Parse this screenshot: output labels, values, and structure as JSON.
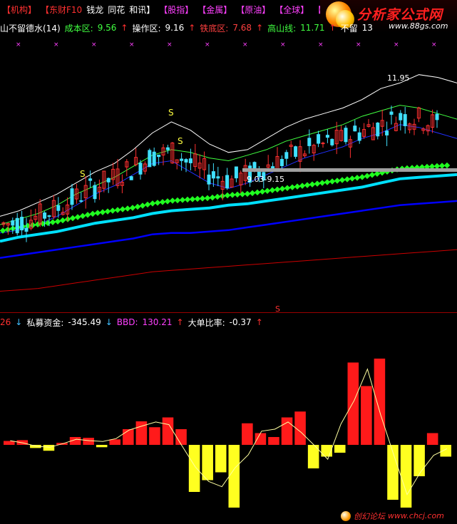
{
  "menu": [
    {
      "label": "【机构】",
      "color": "#ff3030"
    },
    {
      "label": "【东财F10",
      "color": "#ff3030"
    },
    {
      "label": "钱龙",
      "color": "#ffffff"
    },
    {
      "label": "同花",
      "color": "#ffffff"
    },
    {
      "label": "和讯】",
      "color": "#ffffff"
    },
    {
      "label": "【股指】",
      "color": "#ff40ff"
    },
    {
      "label": "【金属】",
      "color": "#ff40ff"
    },
    {
      "label": "【原油】",
      "color": "#ff40ff"
    },
    {
      "label": "【全球】",
      "color": "#ff40ff"
    },
    {
      "label": "【",
      "color": "#ff40ff"
    }
  ],
  "logo": {
    "text": "分析家公式网",
    "url": "www.88gs.com"
  },
  "indicator_main": {
    "name": "山不留德水(14)",
    "items": [
      {
        "label": "成本区:",
        "value": "9.56",
        "color": "#40ff40",
        "arrow": "↑"
      },
      {
        "label": "操作区:",
        "value": "9.16",
        "color": "#ffffff",
        "arrow": "↑"
      },
      {
        "label": "铁底区:",
        "value": "7.68",
        "color": "#ff4040",
        "arrow": "↑"
      },
      {
        "label": "高山线:",
        "value": "11.71",
        "color": "#40ff40",
        "arrow": "↑"
      },
      {
        "label": "不留",
        "value": "13",
        "color": "#ffffff",
        "arrow": ""
      }
    ]
  },
  "indicator_sub": {
    "prefix": "26",
    "prefix_arrow": "↓",
    "items": [
      {
        "label": "私募资金:",
        "value": "-345.49",
        "color": "#ffffff",
        "arrow": "↓",
        "arrow_color": "#40c0ff"
      },
      {
        "label": "BBD:",
        "value": "130.21",
        "color": "#ff40ff",
        "arrow": "↑",
        "arrow_color": "#ff3030"
      },
      {
        "label": "大单比率:",
        "value": "-0.37",
        "color": "#ffffff",
        "arrow": "↑",
        "arrow_color": "#ff3030"
      }
    ]
  },
  "annotations": {
    "high": "11.95",
    "band": "9.03-9.15",
    "sell_marker": "S"
  },
  "footer": {
    "text": "创幻论坛",
    "url": "www.chcj.com"
  },
  "chart_data": [
    {
      "type": "line",
      "series": [
        {
          "color": "#ffffff",
          "values": [
            8.2,
            8.4,
            8.7,
            9.0,
            9.4,
            9.8,
            10.1,
            10.6,
            11.2,
            11.6,
            11.3,
            10.8,
            10.5,
            10.6,
            11.0,
            11.4,
            11.7,
            11.9,
            12.1,
            12.4,
            12.8,
            13.0,
            13.3,
            13.2,
            13.0
          ]
        },
        {
          "color": "#40ff40",
          "values": [
            7.9,
            8.1,
            8.3,
            8.6,
            9.0,
            9.3,
            9.6,
            10.0,
            10.4,
            10.6,
            10.5,
            10.3,
            10.2,
            10.4,
            10.6,
            10.9,
            11.1,
            11.3,
            11.5,
            11.8,
            12.0,
            12.2,
            12.1,
            11.9,
            11.7
          ]
        },
        {
          "color": "#2030ff",
          "values": [
            7.6,
            7.7,
            7.9,
            8.2,
            8.6,
            9.0,
            9.3,
            9.7,
            10.1,
            10.2,
            9.8,
            9.4,
            9.2,
            9.4,
            9.7,
            10.0,
            10.3,
            10.5,
            10.7,
            11.0,
            11.2,
            11.5,
            11.4,
            11.2,
            11.0
          ]
        },
        {
          "color": "#00e0ff",
          "values": [
            7.3,
            7.45,
            7.55,
            7.65,
            7.8,
            7.95,
            8.05,
            8.15,
            8.3,
            8.4,
            8.45,
            8.5,
            8.6,
            8.65,
            8.75,
            8.85,
            8.95,
            9.05,
            9.15,
            9.25,
            9.4,
            9.55,
            9.6,
            9.65,
            9.7
          ]
        },
        {
          "color": "#0000ff",
          "values": [
            6.7,
            6.8,
            6.9,
            7.0,
            7.1,
            7.2,
            7.3,
            7.4,
            7.55,
            7.6,
            7.6,
            7.65,
            7.7,
            7.8,
            7.9,
            8.0,
            8.1,
            8.2,
            8.3,
            8.4,
            8.5,
            8.6,
            8.65,
            8.7,
            8.75
          ]
        },
        {
          "color": "#cc0000",
          "values": [
            5.5,
            5.55,
            5.6,
            5.7,
            5.8,
            5.9,
            6.0,
            6.1,
            6.2,
            6.25,
            6.3,
            6.35,
            6.4,
            6.45,
            6.5,
            6.55,
            6.6,
            6.65,
            6.7,
            6.75,
            6.8,
            6.85,
            6.9,
            6.95,
            7.0
          ]
        }
      ]
    },
    {
      "type": "bar",
      "series": [
        {
          "name": "私募资金",
          "values": [
            10,
            12,
            -8,
            -15,
            5,
            20,
            18,
            -6,
            14,
            40,
            60,
            45,
            70,
            40,
            -120,
            -90,
            -70,
            -160,
            55,
            30,
            20,
            70,
            85,
            -60,
            -30,
            -20,
            210,
            150,
            220,
            -140,
            -160,
            -80,
            30,
            -30
          ]
        }
      ]
    }
  ]
}
